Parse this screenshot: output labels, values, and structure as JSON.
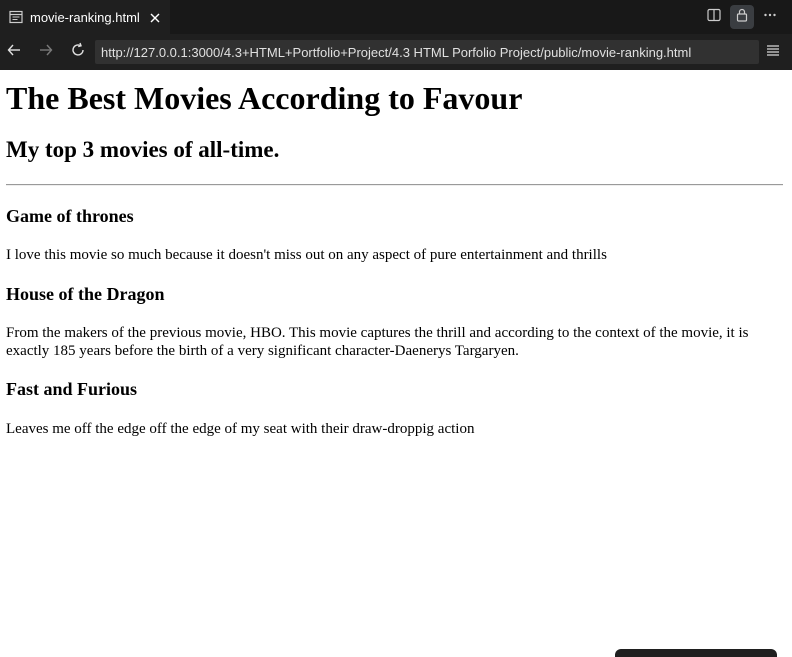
{
  "editor": {
    "tab": {
      "title": "movie-ranking.html"
    }
  },
  "browser": {
    "url": "http://127.0.0.1:3000/4.3+HTML+Portfolio+Project/4.3 HTML Porfolio Project/public/movie-ranking.html"
  },
  "page": {
    "title": "The Best Movies According to Favour",
    "subtitle": "My top 3 movies of all-time.",
    "movies": [
      {
        "title": "Game of thrones",
        "description": "I love this movie so much because it doesn't miss out on any aspect of pure entertainment and thrills"
      },
      {
        "title": "House of the Dragon",
        "description": "From the makers of the previous movie, HBO. This movie captures the thrill and according to the context of the movie, it is exactly 185 years before the birth of a very significant character-Daenerys Targaryen."
      },
      {
        "title": "Fast and Furious",
        "description": "Leaves me off the edge off the edge of my seat with their draw-droppig action"
      }
    ]
  },
  "icons": {
    "tab": "preview-file-icon",
    "close": "close-icon",
    "split": "split-editor-icon",
    "lock": "lock-icon",
    "more": "more-actions-icon",
    "back": "back-arrow-icon",
    "forward": "forward-arrow-icon",
    "reload": "reload-icon",
    "menu": "hamburger-menu-icon"
  },
  "colors": {
    "chrome_dark": "#181818",
    "toolbar": "#1f1f1f",
    "urlbar": "#313131",
    "page_background": "#ffffff"
  }
}
